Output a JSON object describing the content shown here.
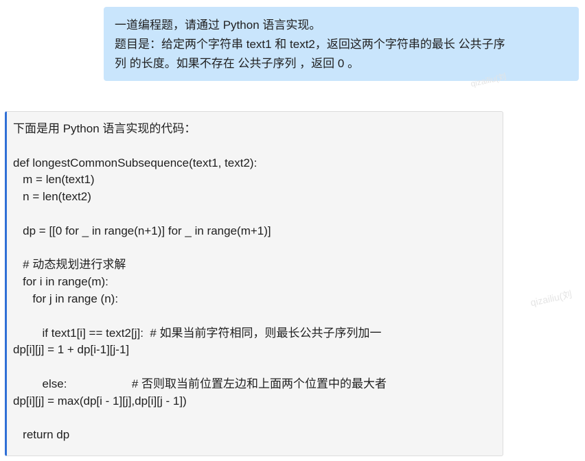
{
  "user_message": {
    "lines": [
      "一道编程题，请通过 Python 语言实现。",
      "题目是：给定两个字符串 text1 和 text2，返回这两个字符串的最长 公共子序",
      "列 的长度。如果不存在 公共子序列 ，返回 0 。"
    ]
  },
  "answer": {
    "lines": [
      "下面是用 Python 语言实现的代码：",
      "",
      "def longestCommonSubsequence(text1, text2):",
      "   m = len(text1)",
      "   n = len(text2)",
      "",
      "   dp = [[0 for _ in range(n+1)] for _ in range(m+1)]",
      "",
      "   # 动态规划进行求解",
      "   for i in range(m):",
      "      for j in range (n):",
      "",
      "         if text1[i] == text2[j]:  # 如果当前字符相同，则最长公共子序列加一",
      "dp[i][j] = 1 + dp[i-1][j-1]",
      "",
      "         else:                    # 否则取当前位置左边和上面两个位置中的最大者",
      "dp[i][j] = max(dp[i - 1][j],dp[i][j - 1])",
      "",
      "   return dp"
    ]
  },
  "watermark": {
    "text_1": "qizailiu(刘",
    "text_2": "qizailiu(刘"
  },
  "colors": {
    "user_bubble_bg": "#c9e5fc",
    "answer_bg": "#f5f5f5",
    "answer_accent": "#2f6fd6"
  }
}
